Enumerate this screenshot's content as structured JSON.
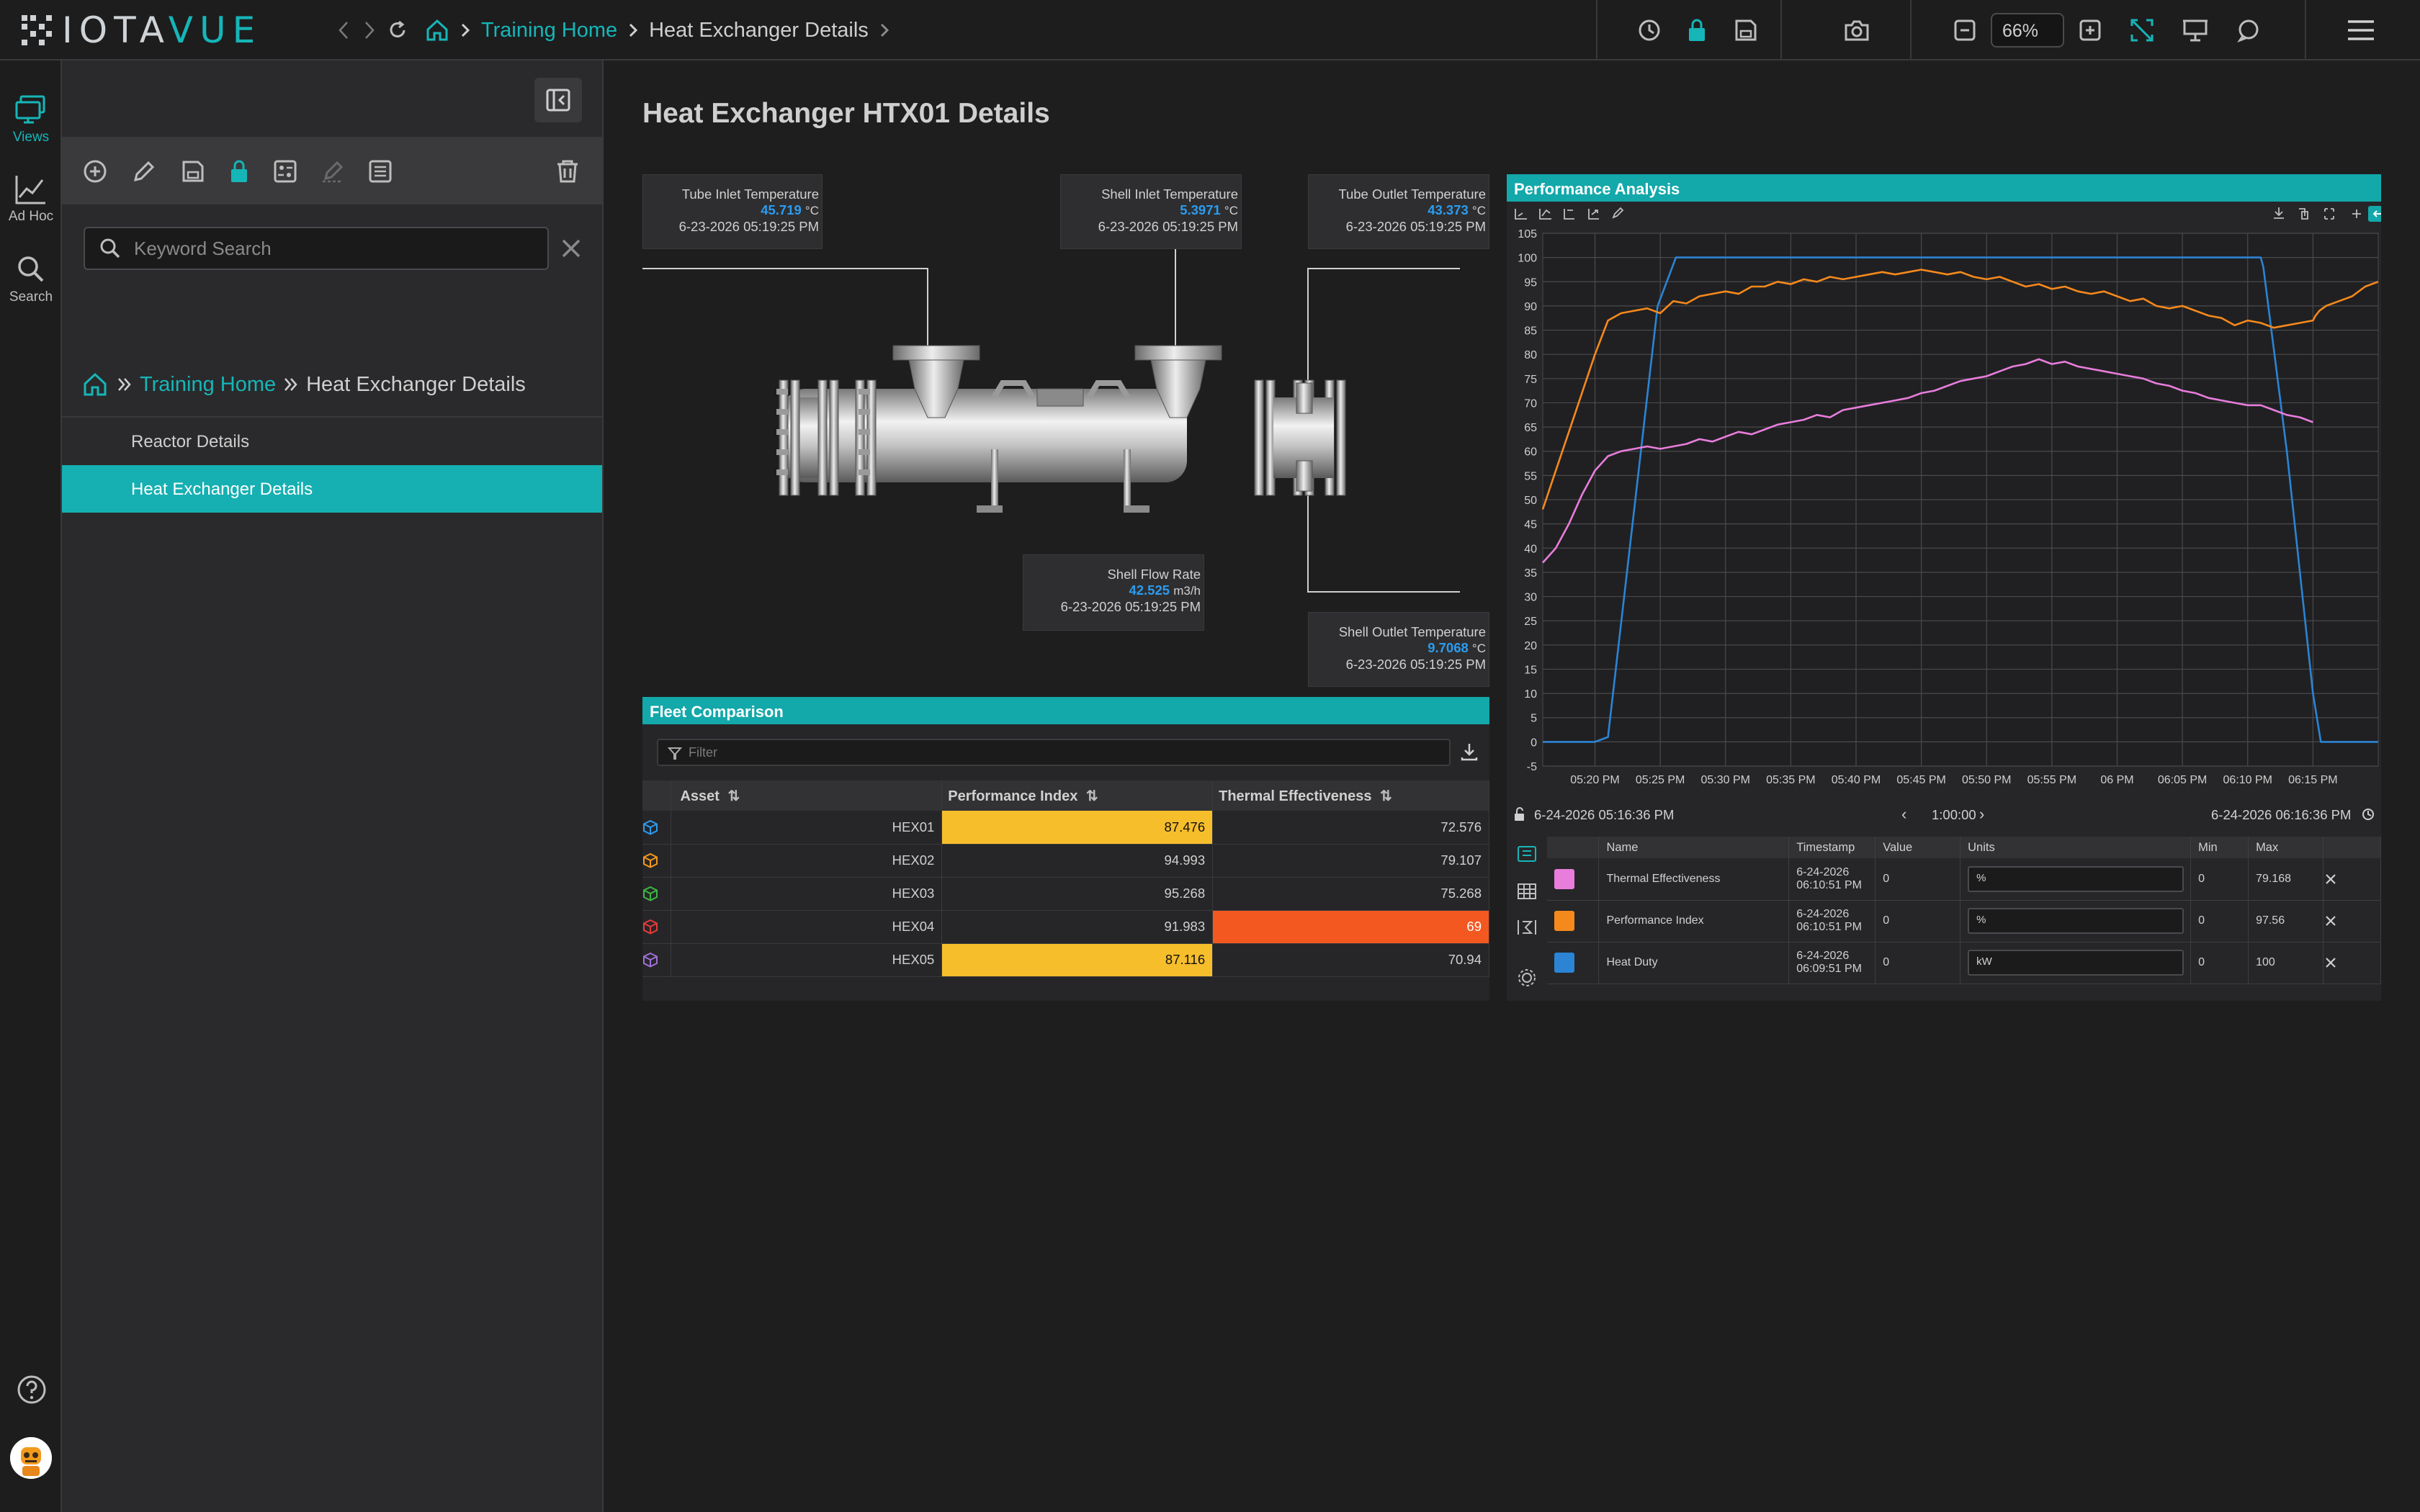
{
  "app": {
    "logo_part1": "IOTA",
    "logo_part2": "VUE",
    "zoom": "66%"
  },
  "top_breadcrumb": {
    "home": "Training Home",
    "current": "Heat Exchanger Details"
  },
  "rail": {
    "views": "Views",
    "adhoc": "Ad Hoc",
    "search": "Search"
  },
  "panel": {
    "search_placeholder": "Keyword Search",
    "breadcrumb_home": "Training Home",
    "breadcrumb_current": "Heat Exchanger Details",
    "items": [
      {
        "label": "Reactor Details"
      },
      {
        "label": "Heat Exchanger Details"
      }
    ]
  },
  "page": {
    "title": "Heat Exchanger HTX01 Details"
  },
  "tags": {
    "tube_inlet": {
      "label": "Tube Inlet Temperature",
      "value": "45.719",
      "unit": "°C",
      "time": "6-23-2026 05:19:25 PM"
    },
    "shell_inlet": {
      "label": "Shell Inlet Temperature",
      "value": "5.3971",
      "unit": "°C",
      "time": "6-23-2026 05:19:25 PM"
    },
    "tube_outlet": {
      "label": "Tube Outlet Temperature",
      "value": "43.373",
      "unit": "°C",
      "time": "6-23-2026 05:19:25 PM"
    },
    "shell_flow": {
      "label": "Shell Flow Rate",
      "value": "42.525",
      "unit": "m3/h",
      "time": "6-23-2026 05:19:25 PM"
    },
    "shell_outlet": {
      "label": "Shell Outlet Temperature",
      "value": "9.7068",
      "unit": "°C",
      "time": "6-23-2026 05:19:25 PM"
    }
  },
  "fleet": {
    "title": "Fleet Comparison",
    "filter_placeholder": "Filter",
    "columns": [
      "Asset",
      "Performance Index",
      "Thermal Effectiveness"
    ],
    "rows": [
      {
        "asset": "HEX01",
        "perf": "87.476",
        "thermal": "72.576",
        "icon_color": "#2b9cf0"
      },
      {
        "asset": "HEX02",
        "perf": "94.993",
        "thermal": "79.107",
        "icon_color": "#f39a1c"
      },
      {
        "asset": "HEX03",
        "perf": "95.268",
        "thermal": "75.268",
        "icon_color": "#3cb843"
      },
      {
        "asset": "HEX04",
        "perf": "91.983",
        "thermal": "69",
        "icon_color": "#e83a3a"
      },
      {
        "asset": "HEX05",
        "perf": "87.116",
        "thermal": "70.94",
        "icon_color": "#a070d8"
      }
    ]
  },
  "perf": {
    "title": "Performance Analysis",
    "start": "6-24-2026 05:16:36 PM",
    "end": "6-24-2026 06:16:36 PM",
    "duration": "1:00:00",
    "legend_columns": [
      "Name",
      "Timestamp",
      "Value",
      "Units",
      "Min",
      "Max"
    ],
    "legend": [
      {
        "name": "Thermal Effectiveness",
        "ts1": "6-24-2026",
        "ts2": "06:10:51 PM",
        "value": "0",
        "units": "%",
        "min": "0",
        "max": "79.168",
        "color": "#e87ddc"
      },
      {
        "name": "Performance Index",
        "ts1": "6-24-2026",
        "ts2": "06:10:51 PM",
        "value": "0",
        "units": "%",
        "min": "0",
        "max": "97.56",
        "color": "#f5891c"
      },
      {
        "name": "Heat Duty",
        "ts1": "6-24-2026",
        "ts2": "06:09:51 PM",
        "value": "0",
        "units": "kW",
        "min": "0",
        "max": "100",
        "color": "#2b84d4"
      }
    ]
  },
  "chart_data": {
    "type": "line",
    "title": "Performance Analysis",
    "x_ticks": [
      "05:20 PM",
      "05:25 PM",
      "05:30 PM",
      "05:35 PM",
      "05:40 PM",
      "05:45 PM",
      "05:50 PM",
      "05:55 PM",
      "06 PM",
      "06:05 PM",
      "06:10 PM",
      "06:15 PM"
    ],
    "y_ticks": [
      105,
      100,
      95,
      90,
      85,
      80,
      75,
      70,
      65,
      60,
      55,
      50,
      45,
      40,
      35,
      30,
      25,
      20,
      15,
      10,
      5,
      0,
      -5
    ],
    "xlim": [
      -4,
      60
    ],
    "ylim": [
      -5,
      105
    ],
    "grid": true,
    "series": [
      {
        "name": "Heat Duty",
        "color": "#2b84d4",
        "x": [
          -4,
          -2,
          0,
          1,
          4.8,
          6.2,
          10,
          20,
          30,
          40,
          50,
          51,
          51.2,
          53,
          55,
          55.6,
          56.5,
          60
        ],
        "y": [
          0,
          0,
          0,
          1,
          90,
          100,
          100,
          100,
          100,
          100,
          100,
          100,
          98,
          60,
          10,
          0,
          0,
          0
        ]
      },
      {
        "name": "Performance Index",
        "color": "#f5891c",
        "x": [
          -4,
          -3,
          -2,
          -1,
          0,
          1,
          2,
          3,
          4,
          5,
          6,
          7,
          8,
          9,
          10,
          11,
          12,
          13,
          14,
          15,
          16,
          17,
          18,
          19,
          20,
          21,
          22,
          23,
          24,
          25,
          26,
          27,
          28,
          29,
          30,
          31,
          32,
          33,
          34,
          35,
          36,
          37,
          38,
          39,
          40,
          41,
          42,
          43,
          44,
          45,
          46,
          47,
          48,
          49,
          50,
          51,
          52,
          53,
          54,
          55,
          55.2,
          55.5,
          56,
          57,
          58,
          59,
          60
        ],
        "y": [
          48,
          56,
          64,
          72,
          80,
          87,
          88.5,
          89,
          89.5,
          88.5,
          91,
          90.5,
          92,
          92.5,
          93,
          92.5,
          94,
          94,
          95,
          94.5,
          95.5,
          95,
          96,
          95.5,
          96,
          96.5,
          97,
          96.5,
          97,
          97.5,
          97,
          96.5,
          97,
          96,
          95.5,
          96,
          95,
          94,
          94.5,
          93.5,
          94,
          93,
          92.5,
          93,
          92,
          91,
          91.5,
          90,
          89.5,
          90,
          89,
          88,
          87.5,
          86,
          87,
          86.5,
          85.5,
          86,
          86.5,
          87,
          88,
          89,
          90,
          91,
          92,
          94,
          95
        ]
      },
      {
        "name": "Thermal Effectiveness",
        "color": "#e87ddc",
        "x": [
          -4,
          -3,
          -2,
          -1,
          0,
          1,
          2,
          3,
          4,
          5,
          6,
          7,
          8,
          9,
          10,
          11,
          12,
          13,
          14,
          15,
          16,
          17,
          18,
          19,
          20,
          21,
          22,
          23,
          24,
          25,
          26,
          27,
          28,
          29,
          30,
          31,
          32,
          33,
          34,
          35,
          36,
          37,
          38,
          39,
          40,
          41,
          42,
          43,
          44,
          45,
          46,
          47,
          48,
          49,
          50,
          51,
          52,
          53,
          54,
          55
        ],
        "y": [
          37,
          40,
          45,
          51,
          56,
          59,
          60,
          60.5,
          61,
          60.5,
          61,
          61.5,
          62.5,
          62,
          63,
          64,
          63.5,
          64.5,
          65.5,
          66,
          66.5,
          67.5,
          67,
          68.5,
          69,
          69.5,
          70,
          70.5,
          71,
          72,
          72.5,
          73.5,
          74.5,
          75,
          75.5,
          76.5,
          77.5,
          78,
          79,
          78,
          78.5,
          77.5,
          77,
          76.5,
          76,
          75.5,
          75,
          74,
          73.5,
          72.5,
          72,
          71,
          70.5,
          70,
          69.5,
          69.5,
          68.5,
          67.5,
          67,
          66
        ]
      }
    ]
  }
}
